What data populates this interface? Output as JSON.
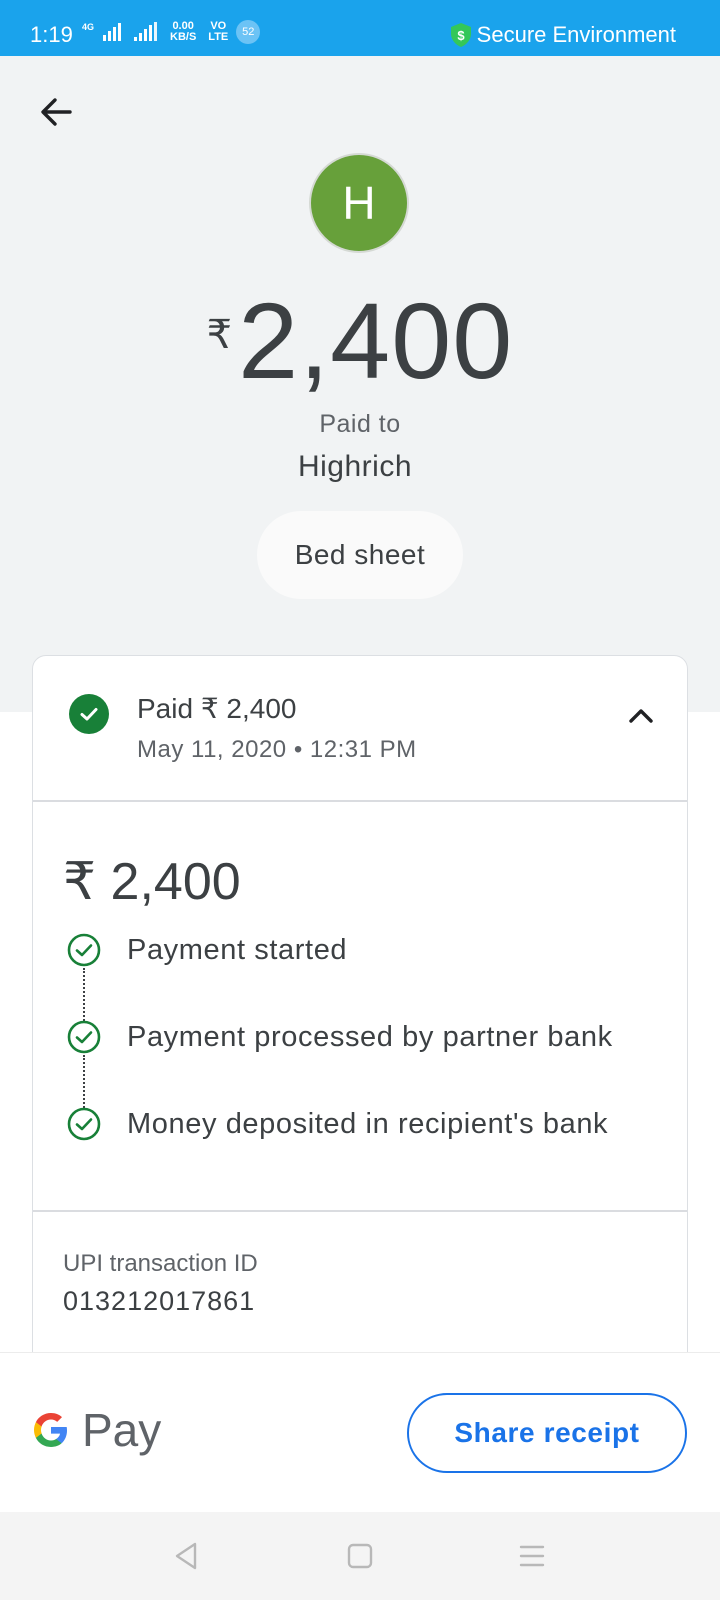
{
  "status_bar": {
    "time": "1:19",
    "network_4g": "4G",
    "speed_value": "0.00",
    "speed_unit": "KB/S",
    "volte_top": "VO",
    "volte_bottom": "LTE",
    "notification_count": "52",
    "secure_label": "Secure Environment",
    "colors": {
      "background": "#1aa3ec",
      "shield": "#34c759"
    }
  },
  "header": {
    "avatar_initial": "H",
    "currency_symbol": "₹",
    "amount": "2,400",
    "paid_to_label": "Paid to",
    "payee_name": "Highrich",
    "note": "Bed sheet",
    "colors": {
      "avatar": "#67a03a",
      "background": "#f1f3f4"
    }
  },
  "details_card": {
    "status_title": "Paid ₹ 2,400",
    "status_datetime": "May 11, 2020 • 12:31 PM",
    "amount": "₹ 2,400",
    "steps": [
      {
        "label": "Payment started",
        "icon": "check-circle-outline-icon"
      },
      {
        "label": "Payment processed by partner bank",
        "icon": "check-circle-outline-icon"
      },
      {
        "label": "Money deposited in recipient's bank",
        "icon": "check-circle-outline-icon"
      }
    ],
    "upi_label": "UPI transaction ID",
    "upi_id": "013212017861",
    "colors": {
      "success": "#188038"
    }
  },
  "footer": {
    "brand_text": "Pay",
    "share_label": "Share receipt",
    "colors": {
      "accent": "#1a73e8"
    }
  },
  "nav_bar": {
    "back": "triangle-back-icon",
    "home": "square-home-icon",
    "menu": "three-line-menu-icon"
  }
}
